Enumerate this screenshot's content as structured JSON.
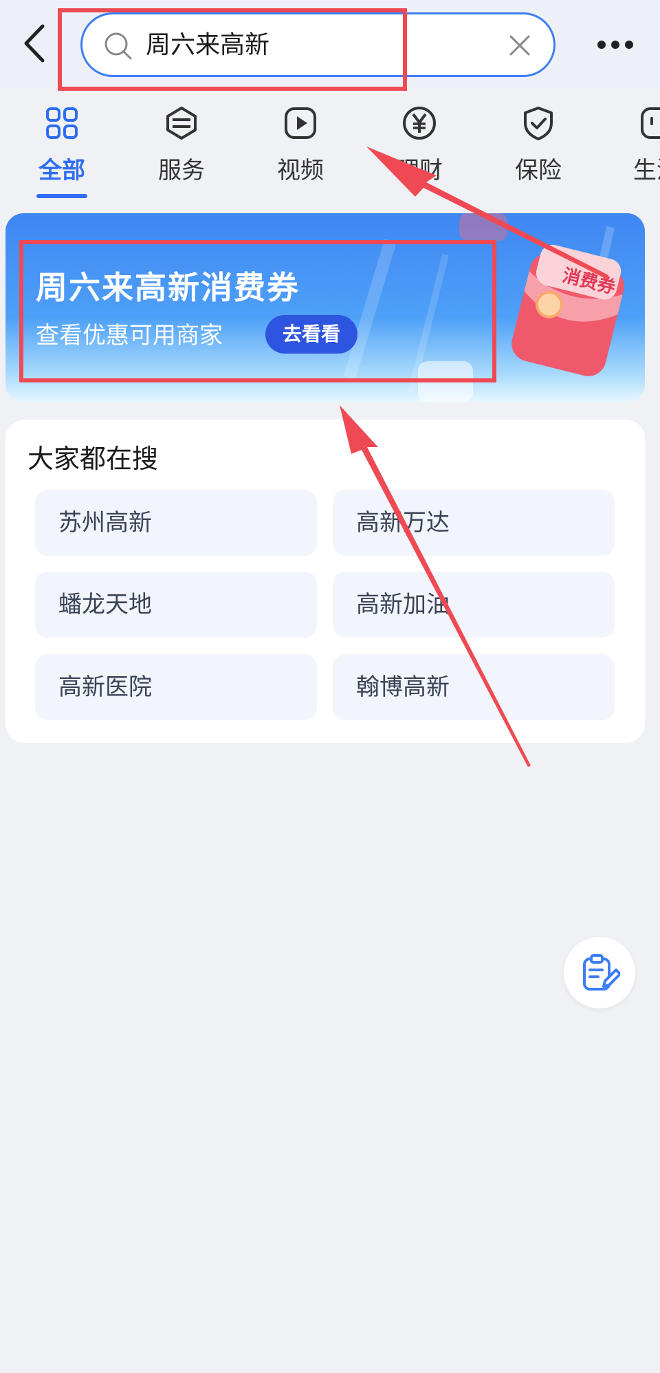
{
  "search": {
    "query": "周六来高新"
  },
  "tabs": [
    {
      "label": "全部",
      "icon": "grid-icon",
      "active": true
    },
    {
      "label": "服务",
      "icon": "cube-icon",
      "active": false
    },
    {
      "label": "视频",
      "icon": "play-icon",
      "active": false
    },
    {
      "label": "理财",
      "icon": "yen-icon",
      "active": false
    },
    {
      "label": "保险",
      "icon": "shield-icon",
      "active": false
    },
    {
      "label": "生活",
      "icon": "smile-icon",
      "active": false
    }
  ],
  "banner": {
    "title": "周六来高新消费券",
    "subtitle": "查看优惠可用商家",
    "button_label": "去看看",
    "coupon_label": "消费券"
  },
  "hot_search": {
    "title": "大家都在搜",
    "items": [
      "苏州高新",
      "高新万达",
      "蟠龙天地",
      "高新加油",
      "高新医院",
      "翰博高新"
    ]
  },
  "colors": {
    "accent": "#2f6ef2",
    "highlight": "#ef4a54",
    "banner_button": "#2e55e0",
    "background": "#f0f1f5"
  }
}
